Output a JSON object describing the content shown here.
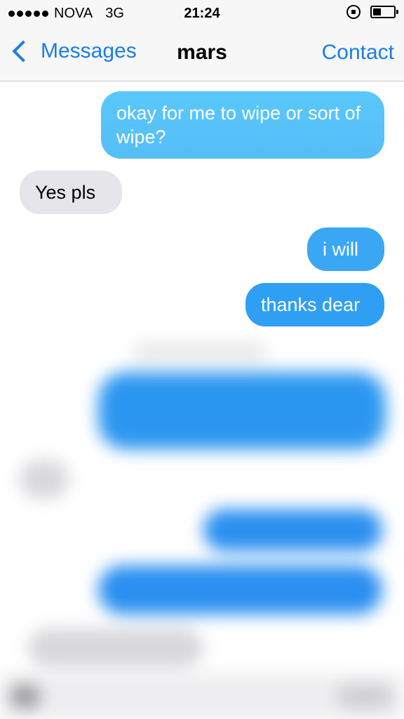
{
  "status_bar": {
    "carrier": "NOVA",
    "network": "3G",
    "time": "21:24",
    "battery_level_percent": 40
  },
  "nav": {
    "back_label": "Messages",
    "title": "mars",
    "contact_label": "Contact"
  },
  "messages": [
    {
      "direction": "outgoing",
      "text": "okay for me to wipe or sort of wipe?"
    },
    {
      "direction": "incoming",
      "text": "Yes pls"
    },
    {
      "direction": "outgoing",
      "text": "i will"
    },
    {
      "direction": "outgoing",
      "text": "thanks dear"
    }
  ],
  "colors": {
    "accent": "#1a7ee6",
    "outgoing_bubble_light": "#5ac8fa",
    "outgoing_bubble_dark": "#2196f3",
    "incoming_bubble": "#e5e5ea"
  }
}
